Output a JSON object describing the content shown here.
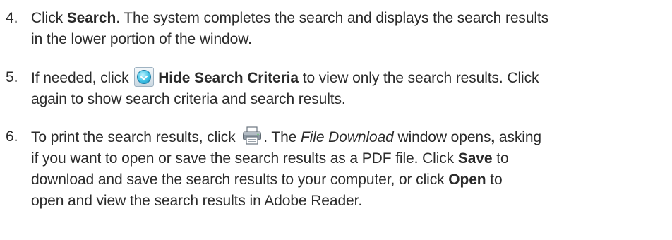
{
  "steps": [
    {
      "number": "4.",
      "lines": [
        {
          "t1": "Click ",
          "b1": "Search",
          "t2": ". The system completes the search and displays the search results"
        },
        {
          "t1": "in the lower portion of the window."
        }
      ]
    },
    {
      "number": "5.",
      "lines": [
        {
          "t1": "If needed, click ",
          "icon": "hide-search-criteria-icon",
          "b1": "Hide Search Criteria",
          "t2": " to view only the search results. Click"
        },
        {
          "t1": "again to show search criteria and search results."
        }
      ]
    },
    {
      "number": "6.",
      "lines": [
        {
          "t1": "To print the search results, click ",
          "icon": "printer-icon",
          "t2": ". The ",
          "i1": "File Download",
          "t3": " window opens",
          "b1": ",",
          "t4": " asking"
        },
        {
          "t1": "if you want to open or save the search results as a PDF file. Click ",
          "b1": "Save",
          "t2": " to"
        },
        {
          "t1": "download and save the search results to your computer, or click ",
          "b1": "Open",
          "t2": " to"
        },
        {
          "t1": "open and view the search results in Adobe Reader."
        }
      ]
    }
  ]
}
